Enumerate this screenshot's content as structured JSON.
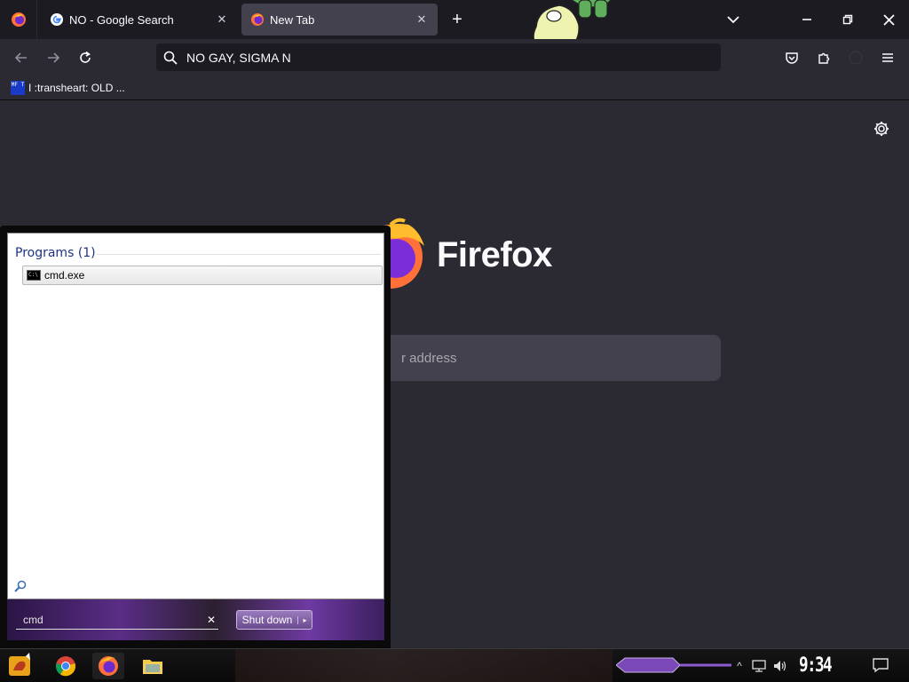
{
  "browser": {
    "tabs": [
      {
        "label": "NO - Google Search",
        "close": "✕",
        "favicon": "google-g-icon"
      },
      {
        "label": "New Tab",
        "close": "✕",
        "favicon": "firefox-icon"
      }
    ],
    "new_tab_symbol": "+",
    "url_value": "NO GAY, SIGMA N",
    "bookmarks": [
      {
        "label": "I :transheart: OLD ...",
        "icon_text": "MF T"
      }
    ],
    "newtab_page": {
      "wordmark": "Firefox",
      "search_placeholder_visible": "r address"
    }
  },
  "start_menu": {
    "section_heading": "Programs (1)",
    "results": [
      {
        "label": "cmd.exe",
        "icon_text": "C:\\"
      }
    ],
    "search_value": "cmd",
    "clear_symbol": "✕",
    "shutdown_label": "Shut down",
    "shutdown_arrow": "▸"
  },
  "taskbar": {
    "clock": "9:34 AM",
    "tray_chevron": "^",
    "apps": [
      "start-orb",
      "chrome",
      "firefox",
      "file-explorer"
    ]
  },
  "colors": {
    "tab_bg": "#1c1b22",
    "toolbar_bg": "#2b2a33",
    "active_tab": "#42414d",
    "start_heading": "#1e3287",
    "accent_purple": "#6f3aa3"
  }
}
